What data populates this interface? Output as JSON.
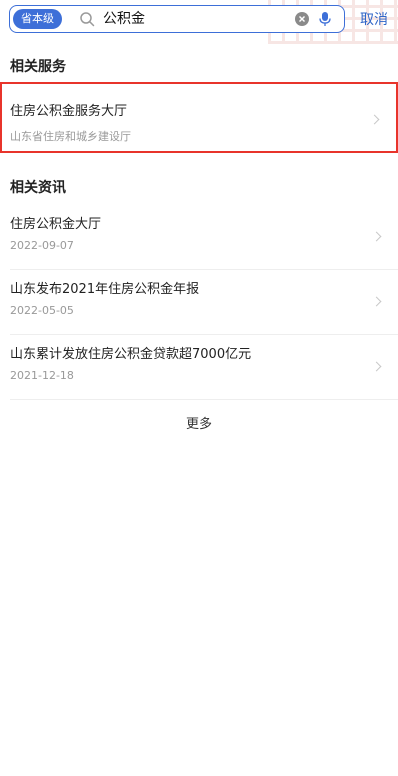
{
  "search": {
    "scope_label": "省本级",
    "query": "公积金",
    "cancel_label": "取消"
  },
  "services": {
    "section_title": "相关服务",
    "items": [
      {
        "name": "住房公积金服务大厅",
        "department": "山东省住房和城乡建设厅"
      }
    ]
  },
  "news": {
    "section_title": "相关资讯",
    "items": [
      {
        "title": "住房公积金大厅",
        "date": "2022-09-07"
      },
      {
        "title": "山东发布2021年住房公积金年报",
        "date": "2022-05-05"
      },
      {
        "title": "山东累计发放住房公积金贷款超7000亿元",
        "date": "2021-12-18"
      }
    ],
    "more_label": "更多"
  },
  "colors": {
    "accent": "#3d6fd8",
    "highlight_border": "#e8342b"
  }
}
